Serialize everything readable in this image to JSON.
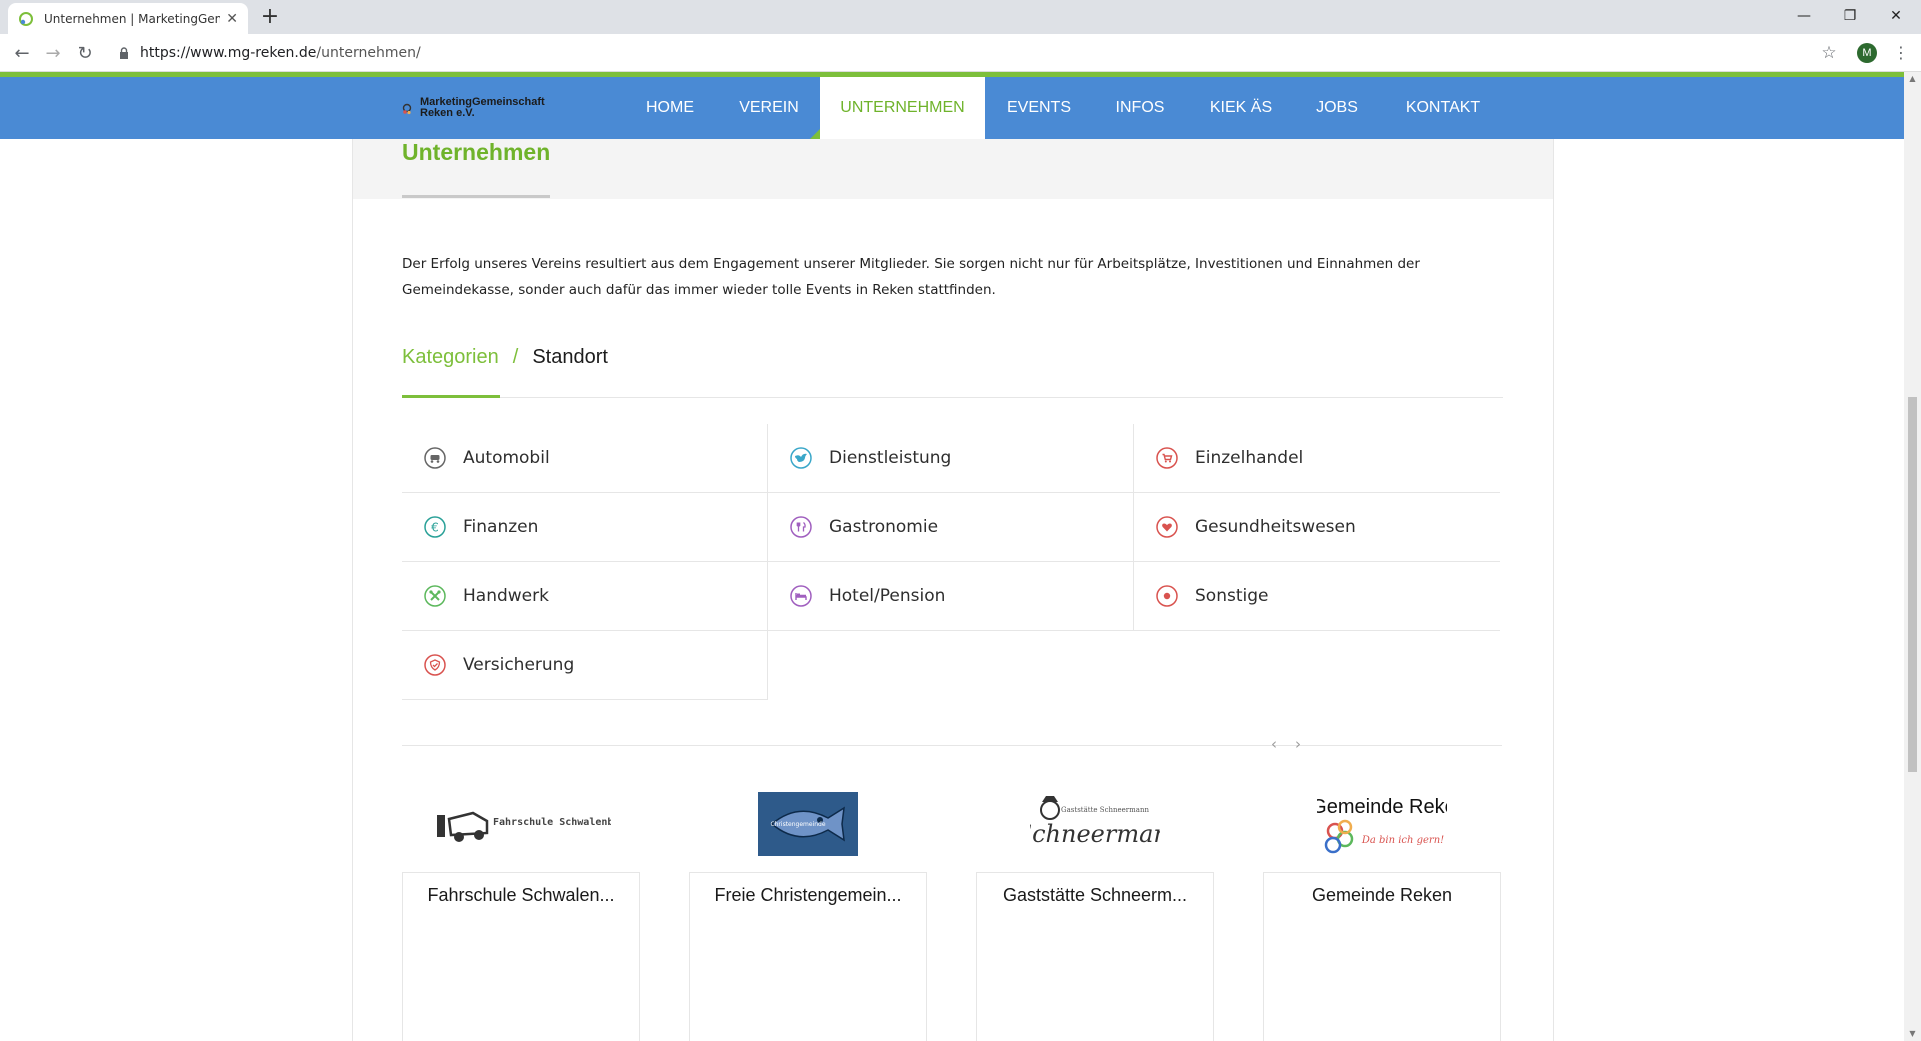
{
  "browser": {
    "tab_title": "Unternehmen | MarketingGeme",
    "url_domain": "https://www.mg-reken.de",
    "url_path": "/unternehmen/",
    "profile_initial": "M"
  },
  "site": {
    "logo_line1": "MarketingGemeinschaft",
    "logo_line2": "Reken e.V.",
    "nav": [
      {
        "label": "HOME"
      },
      {
        "label": "VEREIN"
      },
      {
        "label": "UNTERNEHMEN",
        "active": true
      },
      {
        "label": "EVENTS"
      },
      {
        "label": "INFOS"
      },
      {
        "label": "KIEK ÄS"
      },
      {
        "label": "JOBS"
      },
      {
        "label": "KONTAKT"
      }
    ]
  },
  "page": {
    "title": "Unternehmen",
    "intro": "Der Erfolg unseres Vereins resultiert aus dem Engagement unserer Mitglieder. Sie sorgen nicht nur für Arbeitsplätze, Investitionen und Einnahmen der Gemeindekasse, sonder auch dafür das immer wieder tolle Events in Reken stattfinden.",
    "tab_categories": "Kategorien",
    "tab_separator": "/",
    "tab_location": "Standort"
  },
  "categories": [
    {
      "label": "Automobil",
      "icon": "car-icon",
      "color": "#666666"
    },
    {
      "label": "Dienstleistung",
      "icon": "bird-icon",
      "color": "#3aa7c9"
    },
    {
      "label": "Einzelhandel",
      "icon": "cart-icon",
      "color": "#d9534f"
    },
    {
      "label": "Finanzen",
      "icon": "euro-icon",
      "color": "#2aa198"
    },
    {
      "label": "Gastronomie",
      "icon": "cutlery-icon",
      "color": "#a05fbf"
    },
    {
      "label": "Gesundheitswesen",
      "icon": "heart-icon",
      "color": "#d9534f"
    },
    {
      "label": "Handwerk",
      "icon": "tools-icon",
      "color": "#5cb85c"
    },
    {
      "label": "Hotel/Pension",
      "icon": "bed-icon",
      "color": "#a05fbf"
    },
    {
      "label": "Sonstige",
      "icon": "dot-icon",
      "color": "#d9534f"
    },
    {
      "label": "Versicherung",
      "icon": "shield-icon",
      "color": "#d9534f"
    }
  ],
  "carousel": {
    "prev": "‹",
    "next": "›",
    "companies": [
      {
        "name": "Fahrschule Schwalen...",
        "logo": "Fahrschule Schwalenberg"
      },
      {
        "name": "Freie Christengemein...",
        "logo": "Christengemeinde"
      },
      {
        "name": "Gaststätte Schneerm...",
        "logo": "Gaststätte Schneermann"
      },
      {
        "name": "Gemeinde Reken",
        "logo": "Gemeinde Reken",
        "logo_tagline": "Da bin ich gern!"
      }
    ]
  }
}
